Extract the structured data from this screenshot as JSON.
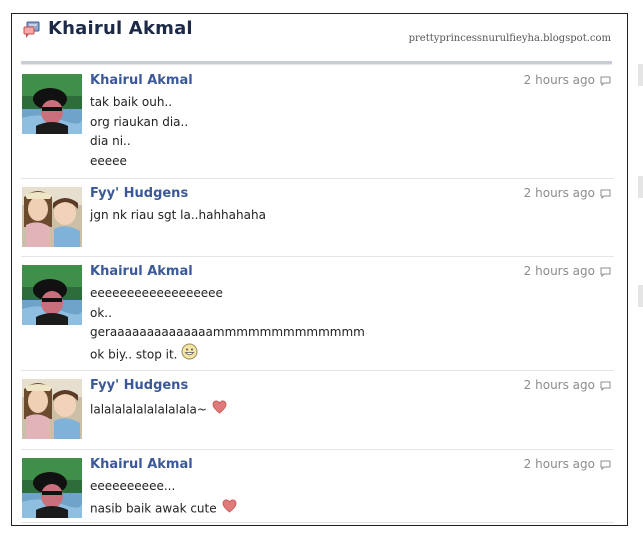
{
  "page": {
    "title": "Khairul Akmal",
    "watermark": "prettyprincessnurulfieyha.blogspot.com"
  },
  "messages": [
    {
      "author": "Khairul Akmal",
      "time": "2 hours ago",
      "avatar": "avatar-khairul",
      "lines": [
        "tak baik ouh..",
        "org riaukan dia..",
        "dia ni..",
        "eeeee"
      ],
      "emoji": null
    },
    {
      "author": "Fyy' Hudgens",
      "time": "2 hours ago",
      "avatar": "avatar-fyy",
      "lines": [
        "jgn nk riau sgt la..hahhahaha"
      ],
      "emoji": null
    },
    {
      "author": "Khairul Akmal",
      "time": "2 hours ago",
      "avatar": "avatar-khairul",
      "lines": [
        "eeeeeeeeeeeeeeeeee",
        "ok..",
        "geraaaaaaaaaaaaaammmmmmmmmmmmm",
        "ok biy.. stop it."
      ],
      "emoji": "smiley-icon"
    },
    {
      "author": "Fyy' Hudgens",
      "time": "2 hours ago",
      "avatar": "avatar-fyy",
      "lines": [
        "lalalalalalalalalala~"
      ],
      "emoji": "heart-icon"
    },
    {
      "author": "Khairul Akmal",
      "time": "2 hours ago",
      "avatar": "avatar-khairul",
      "lines": [
        "eeeeeeeeee...",
        "nasib baik awak cute"
      ],
      "emoji": "heart-icon"
    }
  ],
  "colors": {
    "author_link": "#3b5998",
    "title": "#1c2a47",
    "timestamp": "#8c8c8c",
    "divider": "#e3e5e9",
    "heart": "#e07a7a"
  }
}
